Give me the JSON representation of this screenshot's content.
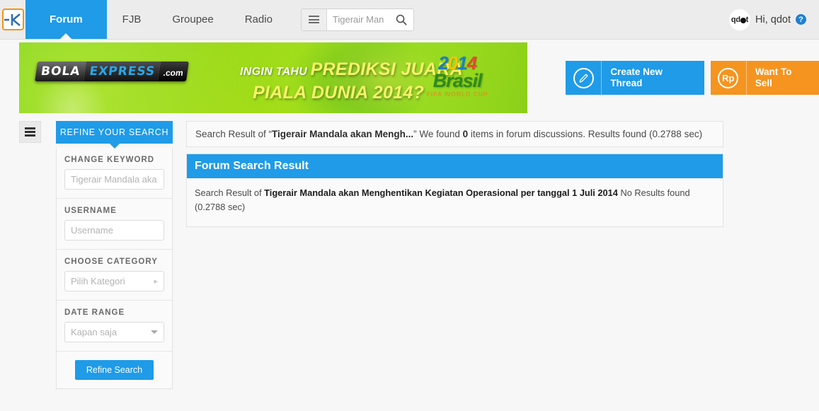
{
  "header": {
    "logo_alt": "kaskus-logo",
    "nav": [
      {
        "label": "Forum",
        "active": true
      },
      {
        "label": "FJB",
        "active": false
      },
      {
        "label": "Groupee",
        "active": false
      },
      {
        "label": "Radio",
        "active": false
      }
    ],
    "search": {
      "category_icon": "hamburger-icon",
      "value": "Tigerair Man",
      "placeholder": "Tigerair Man",
      "go_icon": "search-icon"
    },
    "user": {
      "avatar_text_start": "qd",
      "avatar_text_end": "t",
      "greeting": "Hi, qdot",
      "help_icon_label": "?"
    }
  },
  "banner": {
    "logo_part1": "BOLA",
    "logo_part2": "EXPRESS",
    "logo_part3": ".com",
    "headline_small": "INGIN TAHU",
    "headline_big": "PREDIKSI JUARA",
    "headline_line2": "PIALA DUNIA 2014?",
    "year_a": "2",
    "year_b": "0",
    "year_c": "1",
    "year_d": "4",
    "country": "Brasil",
    "event": "FIFA WORLD CUP"
  },
  "cta": {
    "create_thread_icon": "pencil-icon",
    "create_thread_label": "Create New Thread",
    "create_thread_color": "#1f9be8",
    "want_to_sell_icon": "Rp",
    "want_to_sell_label": "Want To Sell",
    "want_to_sell_color": "#f5941f"
  },
  "sidebar": {
    "toggle_icon": "hamburger-icon",
    "title": "REFINE YOUR SEARCH",
    "sections": [
      {
        "label": "CHANGE KEYWORD",
        "type": "input",
        "value": "",
        "placeholder": "Tigerair Mandala aka"
      },
      {
        "label": "USERNAME",
        "type": "input",
        "value": "",
        "placeholder": "Username"
      },
      {
        "label": "CHOOSE CATEGORY",
        "type": "select-chevron",
        "value": "Pilih Kategori"
      },
      {
        "label": "DATE RANGE",
        "type": "select-caret",
        "value": "Kapan saja"
      }
    ],
    "submit_label": "Refine Search"
  },
  "main": {
    "result_strip": {
      "prefix": "Search Result of “",
      "query_short": "Tigerair Mandala akan Mengh...",
      "middle": "” We found ",
      "count": "0",
      "suffix": " items in forum discussions. Results found (0.2788 sec)"
    },
    "panel": {
      "title": "Forum Search Result",
      "body_prefix": "Search Result of ",
      "body_query": "Tigerair Mandala akan Menghentikan Kegiatan Operasional per tanggal 1 Juli 2014",
      "body_suffix": " No Results found (0.2788 sec)"
    }
  },
  "colors": {
    "accent_blue": "#1f9be8",
    "accent_orange": "#f5941f",
    "header_bg": "#ececec",
    "page_bg": "#f7f7f7"
  }
}
